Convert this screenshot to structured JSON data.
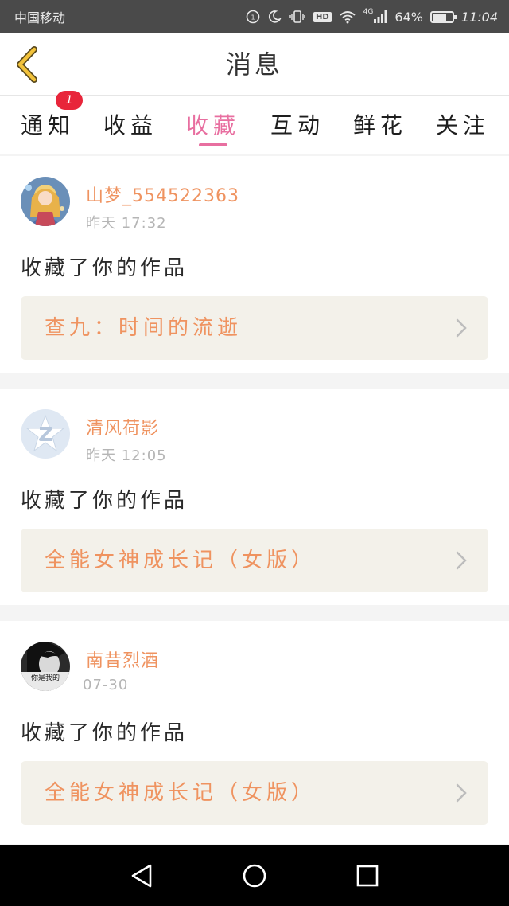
{
  "status_bar": {
    "carrier": "中国移动",
    "battery_percent": "64%",
    "battery_level": 0.64,
    "time": "11:04",
    "network": "4G",
    "hd": "HD"
  },
  "header": {
    "title": "消息"
  },
  "tabs": [
    {
      "label": "通知",
      "badge": "1",
      "active": false
    },
    {
      "label": "收益",
      "active": false
    },
    {
      "label": "收藏",
      "active": true
    },
    {
      "label": "互动",
      "active": false
    },
    {
      "label": "鲜花",
      "active": false
    },
    {
      "label": "关注",
      "active": false
    }
  ],
  "messages": [
    {
      "username": "山梦_554522363",
      "time": "昨天  17:32",
      "action": "收藏了你的作品",
      "work_title": "查九：时间的流逝"
    },
    {
      "username": "清风荷影",
      "time": "昨天  12:05",
      "action": "收藏了你的作品",
      "work_title": "全能女神成长记（女版）"
    },
    {
      "username": "南昔烈酒",
      "time": "07-30",
      "action": "收藏了你的作品",
      "work_title": "全能女神成长记（女版）",
      "avatar_text": "你是我的"
    }
  ],
  "colors": {
    "accent_pink": "#e86fa0",
    "username_orange": "#ef9360",
    "badge_red": "#e8253a",
    "back_arrow": "#f2c23a"
  }
}
